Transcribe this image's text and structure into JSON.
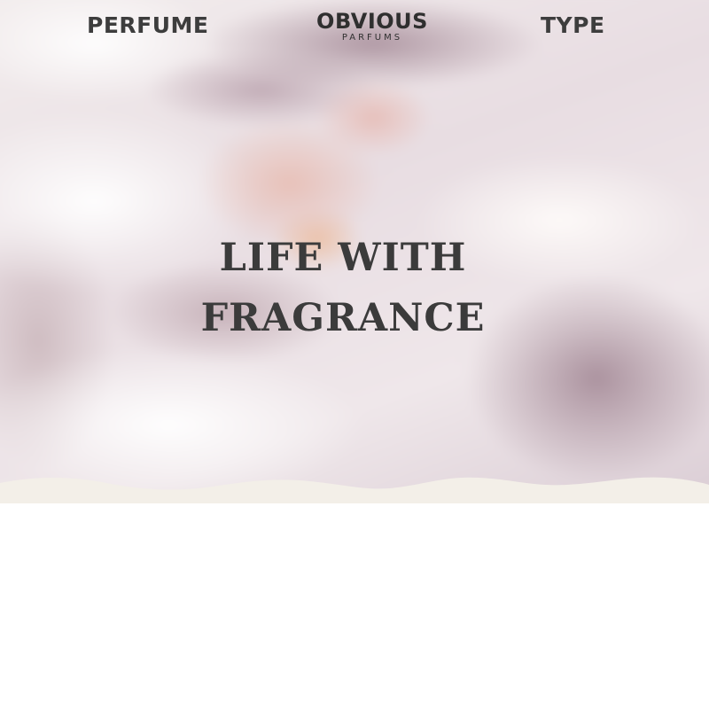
{
  "nav": {
    "left_link": "PERFUME",
    "right_link": "TYPE"
  },
  "logo": {
    "name": "OBVIOUS",
    "subtitle": "PARFUMS"
  },
  "hero": {
    "headline_line1": "LIFE WITH",
    "headline_line2": "FRAGRANCE"
  },
  "colors": {
    "text": "#3b3b3b",
    "wave": "#f3efe8",
    "page_background": "#ffffff"
  }
}
